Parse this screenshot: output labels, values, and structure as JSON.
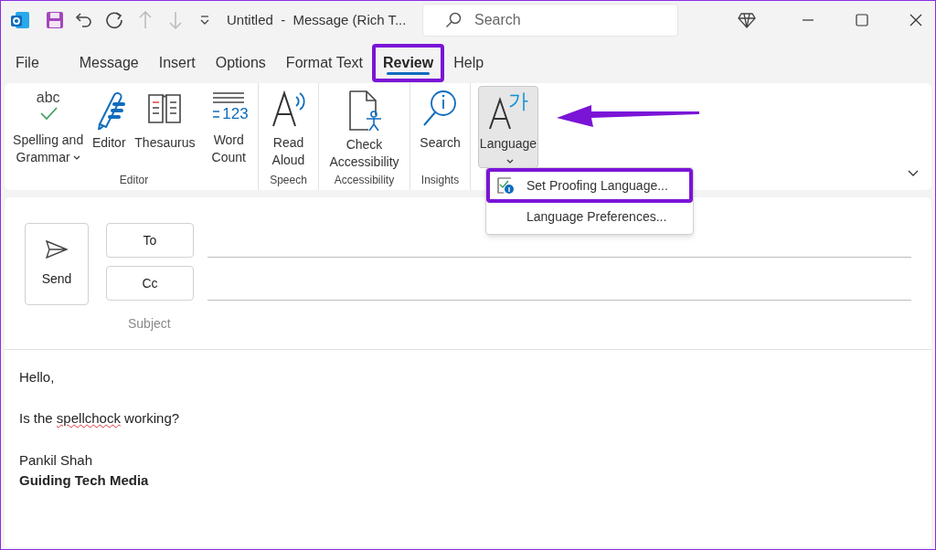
{
  "window": {
    "title": "Untitled  -  Message (Rich T...",
    "search_placeholder": "Search"
  },
  "tabs": [
    {
      "label": "File",
      "selected": false,
      "highlighted": false
    },
    {
      "label": "Message",
      "selected": false,
      "highlighted": false
    },
    {
      "label": "Insert",
      "selected": false,
      "highlighted": false
    },
    {
      "label": "Options",
      "selected": false,
      "highlighted": false
    },
    {
      "label": "Format Text",
      "selected": false,
      "highlighted": false
    },
    {
      "label": "Review",
      "selected": true,
      "highlighted": true
    },
    {
      "label": "Help",
      "selected": false,
      "highlighted": false
    }
  ],
  "ribbon": {
    "groups": [
      {
        "label": "Editor",
        "buttons": [
          {
            "label": "Spelling and Grammar",
            "icon_text": "abc",
            "dropdown": true,
            "pressed": false
          },
          {
            "label": "Editor",
            "dropdown": false,
            "pressed": false
          },
          {
            "label": "Thesaurus",
            "dropdown": false,
            "pressed": false
          },
          {
            "label": "Word Count",
            "icon_text": "123",
            "dropdown": false,
            "pressed": false
          }
        ]
      },
      {
        "label": "Speech",
        "buttons": [
          {
            "label": "Read Aloud",
            "dropdown": false,
            "pressed": false
          }
        ]
      },
      {
        "label": "Accessibility",
        "buttons": [
          {
            "label": "Check Accessibility",
            "dropdown": false,
            "pressed": false
          }
        ]
      },
      {
        "label": "Insights",
        "buttons": [
          {
            "label": "Search",
            "dropdown": false,
            "pressed": false
          }
        ]
      },
      {
        "buttons": [
          {
            "label": "Language",
            "icon_text": "가",
            "dropdown": true,
            "pressed": true
          }
        ]
      }
    ]
  },
  "language_menu": [
    {
      "label": "Set Proofing Language...",
      "highlighted": true
    },
    {
      "label": "Language Preferences...",
      "highlighted": false
    }
  ],
  "compose": {
    "send": "Send",
    "to": "To",
    "cc": "Cc",
    "subject_placeholder": "Subject"
  },
  "body": [
    {
      "parts": [
        {
          "text": "Hello,",
          "misspelled": false
        }
      ],
      "bold": false
    },
    {
      "parts": [
        {
          "text": "Is the ",
          "misspelled": false
        },
        {
          "text": "spellchock",
          "misspelled": true
        },
        {
          "text": " working?",
          "misspelled": false
        }
      ],
      "bold": false
    },
    {
      "parts": [
        {
          "text": "Pankil Shah",
          "misspelled": false
        }
      ],
      "bold": false
    },
    {
      "parts": [
        {
          "text": "Guiding Tech Media",
          "misspelled": false
        }
      ],
      "bold": true
    }
  ]
}
